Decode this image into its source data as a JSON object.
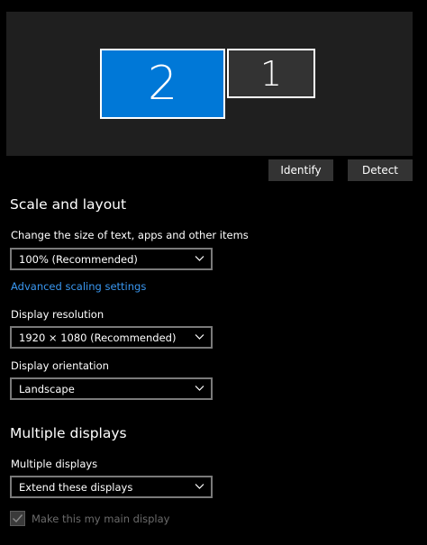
{
  "arrange": {
    "monitor_primary_selected": "2",
    "monitor_secondary": "1"
  },
  "buttons": {
    "identify": "Identify",
    "detect": "Detect"
  },
  "scale_layout": {
    "title": "Scale and layout",
    "size_label": "Change the size of text, apps and other items",
    "size_value": "100% (Recommended)",
    "advanced_link": "Advanced scaling settings",
    "resolution_label": "Display resolution",
    "resolution_value": "1920 × 1080 (Recommended)",
    "orientation_label": "Display orientation",
    "orientation_value": "Landscape"
  },
  "multiple_displays": {
    "title": "Multiple displays",
    "label": "Multiple displays",
    "value": "Extend these displays",
    "main_display_checkbox": "Make this my main display",
    "main_display_checked": true,
    "main_display_disabled": true
  },
  "icons": {
    "dropdown": "chevron-down-icon",
    "checkbox": "checkmark-icon"
  },
  "colors": {
    "accent": "#0078d7",
    "link": "#3a97f0",
    "background": "#000000",
    "panel": "#1f1f1f",
    "button": "#333333"
  }
}
